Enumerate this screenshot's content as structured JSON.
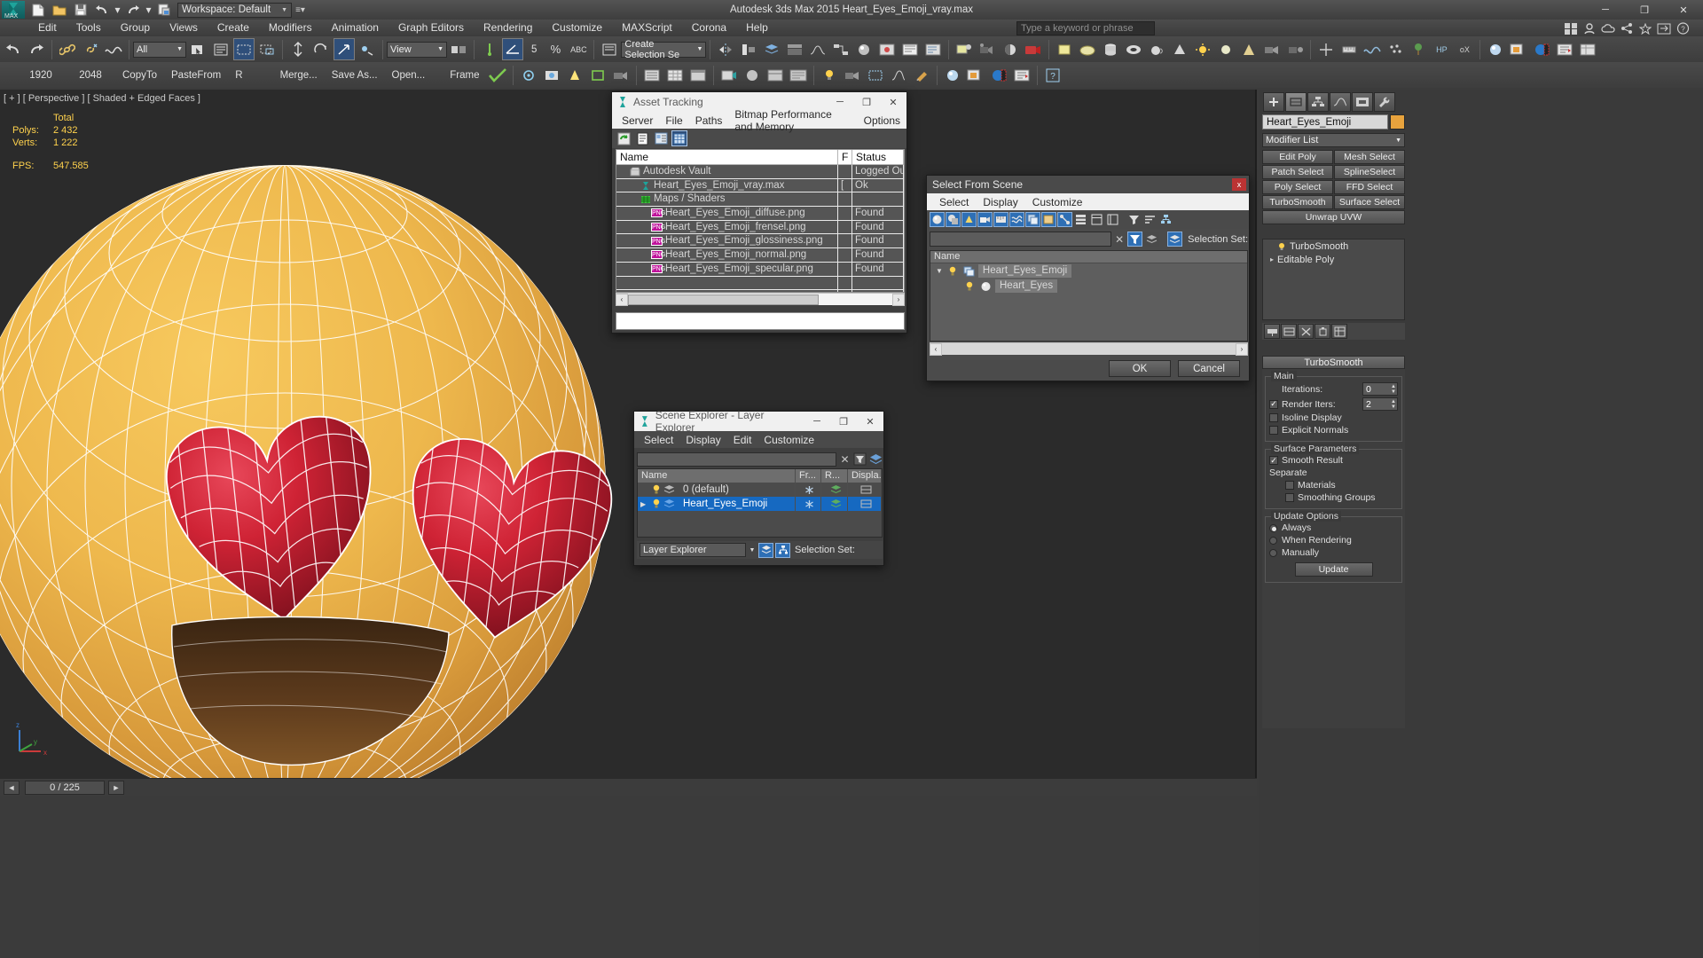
{
  "app": {
    "title": "Autodesk 3ds Max  2015      Heart_Eyes_Emoji_vray.max",
    "logo_label": "MAX",
    "workspace": "Workspace: Default",
    "search_placeholder": "Type a keyword or phrase"
  },
  "window_buttons": {
    "minimize": "─",
    "maximize": "❐",
    "close": "✕"
  },
  "menu": {
    "items": [
      "Edit",
      "Tools",
      "Group",
      "Views",
      "Create",
      "Modifiers",
      "Animation",
      "Graph Editors",
      "Rendering",
      "Customize",
      "MAXScript",
      "Corona",
      "Help"
    ]
  },
  "toolbar1": {
    "selection_filter": "All",
    "view_combo": "View",
    "named_selection_sets": "Create Selection Se",
    "angle_snap": "5",
    "percent_snap": "%",
    "spinner_snap": "ABC"
  },
  "toolbar2": {
    "width": "1920",
    "height": "2048",
    "copy_to": "CopyTo",
    "paste_from": "PasteFrom",
    "r_label": "R",
    "merge": "Merge...",
    "save_as": "Save As...",
    "open": "Open...",
    "frame": "Frame"
  },
  "viewport": {
    "label": "[ + ] [ Perspective ] [ Shaded + Edged Faces ]",
    "stats": {
      "total_header": "Total",
      "polys_label": "Polys:",
      "polys_value": "2 432",
      "verts_label": "Verts:",
      "verts_value": "1 222",
      "fps_label": "FPS:",
      "fps_value": "547.585"
    },
    "axis": {
      "z": "z",
      "y": "y",
      "x": "x"
    }
  },
  "statusbar": {
    "frame_counter": "0 / 225"
  },
  "asset_tracking": {
    "title": "Asset Tracking",
    "menus": [
      "Server",
      "File",
      "Paths",
      "Bitmap Performance and Memory",
      "Options"
    ],
    "columns": [
      "Name",
      "F",
      "Status"
    ],
    "rows": [
      {
        "indent": 1,
        "icon": "vault-icon",
        "name": "Autodesk Vault",
        "f": "",
        "status": "Logged Out"
      },
      {
        "indent": 2,
        "icon": "max-icon",
        "name": "Heart_Eyes_Emoji_vray.max",
        "f": "[",
        "status": "Ok"
      },
      {
        "indent": 2,
        "icon": "maps-icon",
        "name": "Maps / Shaders",
        "f": "",
        "status": ""
      },
      {
        "indent": 3,
        "icon": "png-icon",
        "name": "Heart_Eyes_Emoji_diffuse.png",
        "f": "",
        "status": "Found"
      },
      {
        "indent": 3,
        "icon": "png-icon",
        "name": "Heart_Eyes_Emoji_frensel.png",
        "f": "",
        "status": "Found"
      },
      {
        "indent": 3,
        "icon": "png-icon",
        "name": "Heart_Eyes_Emoji_glossiness.png",
        "f": "",
        "status": "Found"
      },
      {
        "indent": 3,
        "icon": "png-icon",
        "name": "Heart_Eyes_Emoji_normal.png",
        "f": "",
        "status": "Found"
      },
      {
        "indent": 3,
        "icon": "png-icon",
        "name": "Heart_Eyes_Emoji_specular.png",
        "f": "",
        "status": "Found"
      },
      {
        "indent": 0,
        "icon": "",
        "name": "",
        "f": "",
        "status": ""
      },
      {
        "indent": 0,
        "icon": "",
        "name": "",
        "f": "",
        "status": ""
      }
    ],
    "scroll_right": "›",
    "scroll_left": "‹"
  },
  "select_from_scene": {
    "title": "Select From Scene",
    "close": "x",
    "menus": [
      "Select",
      "Display",
      "Customize"
    ],
    "search_value": "",
    "selection_set_label": "Selection Set:",
    "column_name": "Name",
    "tree": [
      {
        "depth": 0,
        "label": "Heart_Eyes_Emoji",
        "icon": "group-icon"
      },
      {
        "depth": 1,
        "label": "Heart_Eyes",
        "icon": "geometry-icon"
      }
    ],
    "ok": "OK",
    "cancel": "Cancel",
    "scroll_left": "‹",
    "scroll_right": "›"
  },
  "layer_explorer": {
    "title": "Scene Explorer - Layer Explorer",
    "menus": [
      "Select",
      "Display",
      "Edit",
      "Customize"
    ],
    "search_value": "",
    "columns": [
      "Name",
      "Fr...",
      "R...",
      "Displa..."
    ],
    "rows": [
      {
        "name": "0 (default)",
        "selected": false,
        "expandable": false
      },
      {
        "name": "Heart_Eyes_Emoji",
        "selected": true,
        "expandable": true
      }
    ],
    "explorer_combo": "Layer Explorer",
    "selection_set_label": "Selection Set:"
  },
  "command_panel": {
    "object_name": "Heart_Eyes_Emoji",
    "object_color": "#e8a33d",
    "modifier_list": "Modifier List",
    "buttons": [
      [
        "Edit Poly",
        "Mesh Select"
      ],
      [
        "Patch Select",
        "SplineSelect"
      ],
      [
        "Poly Select",
        "FFD Select"
      ],
      [
        "TurboSmooth",
        "Surface Select"
      ],
      [
        "Unwrap UVW"
      ]
    ],
    "stack": [
      "TurboSmooth",
      "Editable Poly"
    ],
    "rollout_title": "TurboSmooth",
    "groups": {
      "main": {
        "label": "Main",
        "iterations_label": "Iterations:",
        "iterations_value": "0",
        "render_iters_label": "Render Iters:",
        "render_iters_value": "2",
        "render_iters_checked": true,
        "isoline_display": "Isoline Display",
        "isoline_checked": false,
        "explicit_normals": "Explicit Normals",
        "explicit_checked": false
      },
      "surface_parameters": {
        "label": "Surface Parameters",
        "smooth_result": "Smooth Result",
        "smooth_result_checked": true,
        "separate": "Separate",
        "materials": "Materials",
        "materials_checked": false,
        "smoothing_groups": "Smoothing Groups",
        "smoothing_groups_checked": false
      },
      "update_options": {
        "label": "Update Options",
        "options": [
          "Always",
          "When Rendering",
          "Manually"
        ],
        "selected": "Always",
        "update_button": "Update"
      }
    }
  }
}
